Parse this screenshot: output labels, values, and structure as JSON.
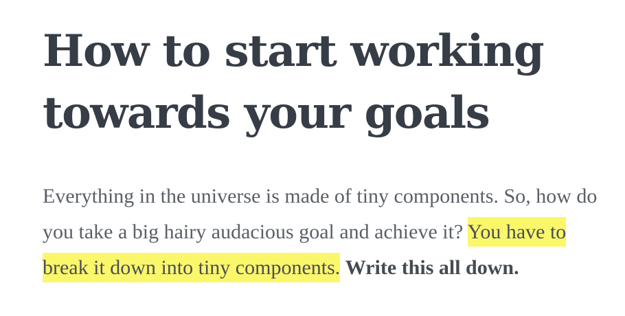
{
  "article": {
    "title": "How to start working towards your goals",
    "paragraph": {
      "intro": "Everything in the universe is made of tiny components. So, how do you take a big hairy audacious goal and achieve it? ",
      "highlight": "You have to break it down into tiny components.",
      "separator": " ",
      "bold": "Write this all down."
    },
    "highlight_color": "#fbf76a",
    "title_color": "#363d47",
    "text_color": "#5a5f67"
  }
}
